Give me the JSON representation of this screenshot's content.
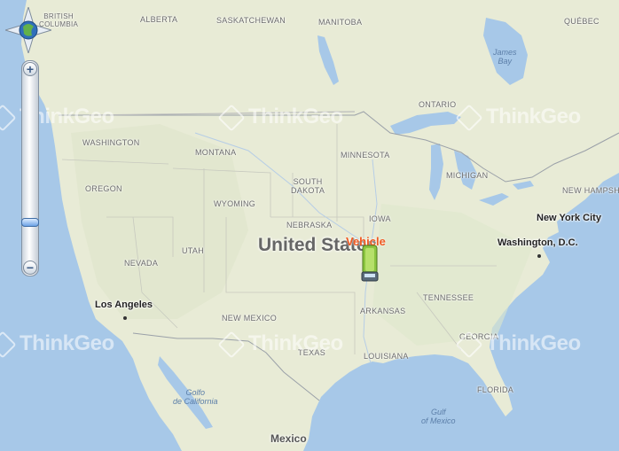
{
  "countries": {
    "united_states": "United States",
    "mexico": "Mexico"
  },
  "regions": {
    "british_columbia": "BRITISH\nCOLUMBIA",
    "alberta": "ALBERTA",
    "saskatchewan": "SASKATCHEWAN",
    "manitoba": "MANITOBA",
    "quebec": "QUÉBEC",
    "ontario": "ONTARIO",
    "washington": "WASHINGTON",
    "montana": "MONTANA",
    "minnesota": "MINNESOTA",
    "oregon": "OREGON",
    "south_dakota": "SOUTH\nDAKOTA",
    "michigan": "MICHIGAN",
    "wyoming": "WYOMING",
    "new_hampshire": "NEW HAMPSHI",
    "iowa": "IOWA",
    "nebraska": "NEBRASKA",
    "nevada": "NEVADA",
    "utah": "UTAH",
    "tennessee": "TENNESSEE",
    "arkansas": "ARKANSAS",
    "new_mexico": "NEW MEXICO",
    "georgia": "GEORGIA",
    "texas": "TEXAS",
    "louisiana": "LOUISIANA",
    "florida": "FLORIDA"
  },
  "cities": {
    "new_york": "New York City",
    "washington_dc": "Washington, D.C.",
    "los_angeles": "Los Angeles"
  },
  "water": {
    "james_bay": "James\nBay",
    "golfo_california": "Golfo\nde California",
    "gulf_mexico": "Gulf\nof Mexico"
  },
  "watermark": "ThinkGeo",
  "vehicle": {
    "label": "Vehicle",
    "color": "#f05a22"
  },
  "controls": {
    "zoom_in": "+",
    "zoom_out": "−",
    "zoom_level": 0.82
  },
  "colors": {
    "water": "#a7c8e8",
    "land": "#e9ecd9",
    "accent": "#3f6da6"
  }
}
